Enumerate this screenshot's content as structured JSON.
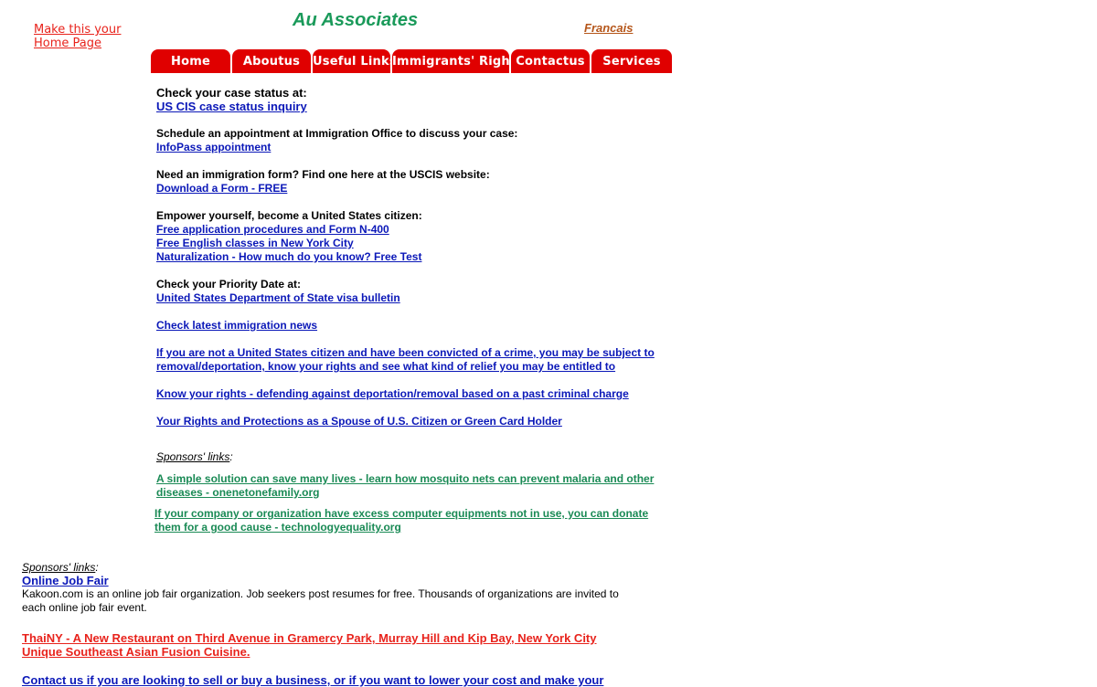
{
  "header": {
    "home_page_link": "Make this your Home Page",
    "site_title": "Au Associates",
    "language_link": "Francais"
  },
  "nav": {
    "tabs": [
      {
        "label": "Home"
      },
      {
        "label": "Aboutus"
      },
      {
        "label": "Useful Links"
      },
      {
        "label": "Immigrants' Rights"
      },
      {
        "label": "Contactus"
      },
      {
        "label": "Services"
      }
    ]
  },
  "colors": {
    "nav_tab_bg": "#e00000",
    "title_green": "#1a9a5a",
    "link_blue": "#0b18b8",
    "sponsor_green": "#1a8a55",
    "red_link": "#e8231c"
  },
  "main": {
    "case_status_label": "Check your case status at:",
    "case_status_link": "US CIS case status inquiry",
    "appointment_label": "Schedule an appointment at Immigration Office to discuss your case:",
    "appointment_link": "InfoPass appointment",
    "form_label": "Need an immigration form? Find one here at the USCIS website:",
    "form_link": "Download a Form - FREE",
    "citizen_label": "Empower yourself, become a United States citizen:",
    "citizen_links": [
      "Free application procedures and Form N-400",
      "Free English classes in New York City",
      "Naturalization - How much do you know? Free Test"
    ],
    "priority_label": "Check your Priority Date at:",
    "priority_link": "United States Department of State visa bulletin",
    "news_link": "Check latest immigration news",
    "crime_link_1": "If you are not a United States citizen and have been convicted of a crime, you may be subject to",
    "crime_link_2": "removal/deportation, know your rights and see what kind of relief you may be entitled to",
    "rights_link": "Know your rights - defending against deportation/removal based on a past criminal charge",
    "spouse_link": "Your Rights and Protections as a Spouse of U.S. Citizen or Green Card Holder",
    "sponsors_header": "Sponsors' links",
    "sponsor_links": [
      "A simple solution can save many lives - learn how mosquito nets can prevent malaria and other diseases - onenetonefamily.org",
      "If your company or organization have excess computer equipments not in use, you can donate them for a good cause - technologyequality.org"
    ]
  },
  "bottom": {
    "sponsors_header": "Sponsors' links",
    "job_fair_link": "Online Job Fair",
    "job_fair_desc": "Kakoon.com is an online job fair organization. Job seekers post resumes for free. Thousands of organizations are invited to each online job fair event.",
    "thai_link_1": "ThaiNY - A New Restaurant on Third Avenue in Gramercy Park, Murray Hill and Kip Bay, New York City",
    "thai_link_2": "Unique Southeast Asian Fusion Cuisine.",
    "contact_link": "Contact us if you are looking to sell or buy a business, or if you want to lower your cost and make your"
  }
}
